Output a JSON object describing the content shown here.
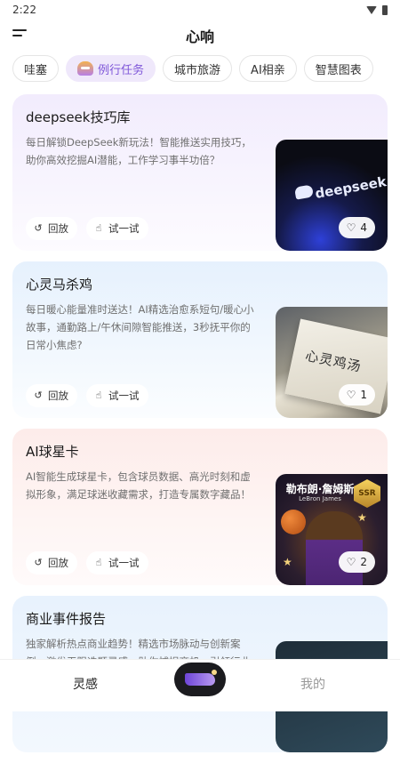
{
  "status_bar": {
    "time": "2:22",
    "icons": [
      "wifi-icon",
      "battery-icon"
    ]
  },
  "header": {
    "title": "心响",
    "menu_icon": "menu-icon"
  },
  "tabs": [
    {
      "label": "哇塞",
      "active": false
    },
    {
      "label": "例行任务",
      "active": true,
      "icon": "basket-icon"
    },
    {
      "label": "城市旅游",
      "active": false
    },
    {
      "label": "AI相亲",
      "active": false
    },
    {
      "label": "智慧图表",
      "active": false
    }
  ],
  "cards": [
    {
      "title": "deepseek技巧库",
      "description": "每日解锁DeepSeek新玩法！智能推送实用技巧，助你高效挖掘AI潜能，工作学习事半功倍？",
      "replay_label": "回放",
      "try_label": "试一试",
      "likes": "4",
      "thumb_text": "deepseek"
    },
    {
      "title": "心灵马杀鸡",
      "description": "每日暖心能量准时送达！AI精选治愈系短句/暖心小故事，通勤路上/午休间隙智能推送，3秒抚平你的日常小焦虑?",
      "replay_label": "回放",
      "try_label": "试一试",
      "likes": "1",
      "thumb_text": "心灵鸡汤"
    },
    {
      "title": "AI球星卡",
      "description": "AI智能生成球星卡，包含球员数据、高光时刻和虚拟形象，满足球迷收藏需求，打造专属数字藏品！",
      "replay_label": "回放",
      "try_label": "试一试",
      "likes": "2",
      "thumb_text": "勒布朗·詹姆斯",
      "thumb_subtext": "LeBron James",
      "badge": "SSR"
    },
    {
      "title": "商业事件报告",
      "description": "独家解析热点商业趋势！精选市场脉动与创新案例，激发无限选题灵感，助你捕捉商机，引领行业"
    }
  ],
  "bottom_nav": {
    "left_label": "灵感",
    "center_icon": "magic-lamp-icon",
    "right_label": "我的"
  }
}
